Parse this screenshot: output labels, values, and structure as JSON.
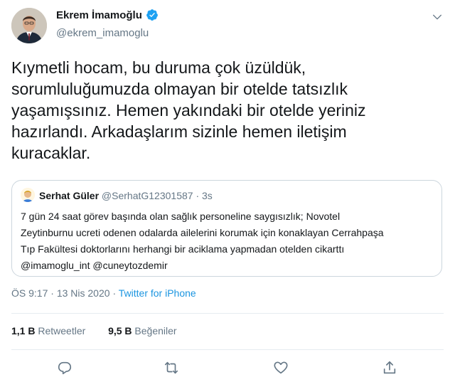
{
  "author": {
    "name": "Ekrem İmamoğlu",
    "handle": "@ekrem_imamoglu",
    "verified_icon": "verified-badge-icon"
  },
  "tweet": {
    "text": "Kıymetli hocam, bu duruma çok üzüldük,\nsorumluluğumuzda olmayan bir otelde tatsızlık\nyaşamışsınız. Hemen yakındaki bir otelde yeriniz\nhazırlandı. Arkadaşlarım sizinle hemen iletişim\nkuracaklar."
  },
  "quote": {
    "name": "Serhat Güler",
    "handle": "@SerhatG12301587",
    "separator": "·",
    "time": "3s",
    "text": "7 gün 24 saat görev başında olan sağlık personeline saygısızlık; Novotel\nZeytinburnu ucreti odenen odalarda ailelerini korumak için konaklayan Cerrahpaşa\nTıp Fakültesi doktorlarını herhangi bir aciklama yapmadan otelden cikarttı\n@imamoglu_int @cuneytozdemir"
  },
  "meta": {
    "time": "ÖS 9:17",
    "dot1": "·",
    "date": "13 Nis 2020",
    "dot2": "·",
    "source": "Twitter for iPhone"
  },
  "stats": {
    "retweets_count": "1,1 B",
    "retweets_label": "Retweetler",
    "likes_count": "9,5 B",
    "likes_label": "Beğeniler"
  },
  "colors": {
    "accent": "#1da1f2",
    "link": "#1b95e0",
    "muted": "#657786",
    "text": "#14171a",
    "border": "#ccd6dd"
  },
  "icons": [
    "reply-icon",
    "retweet-icon",
    "like-icon",
    "share-icon",
    "chevron-down-icon"
  ]
}
